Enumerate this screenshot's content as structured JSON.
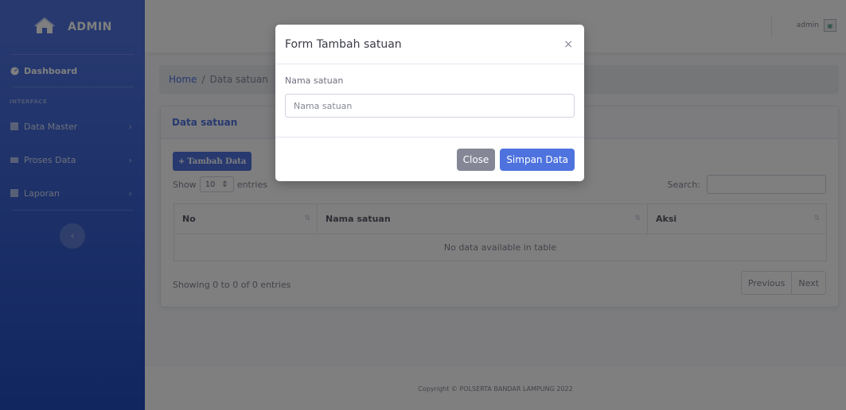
{
  "sidebar": {
    "brand": "ADMIN",
    "dashboard": "Dashboard",
    "heading": "INTERFACE",
    "items": [
      {
        "label": "Data Master"
      },
      {
        "label": "Proses Data"
      },
      {
        "label": "Laporan"
      }
    ]
  },
  "topbar": {
    "user": "admin"
  },
  "breadcrumb": {
    "home": "Home",
    "separator": "/",
    "current": "Data satuan"
  },
  "card": {
    "title": "Data satuan",
    "add_button": "Tambah Data",
    "show_label": "Show",
    "page_size": "10",
    "entries_label": "entries",
    "search_label": "Search:",
    "columns": [
      "No",
      "Nama satuan",
      "Aksi"
    ],
    "empty": "No data available in table",
    "info": "Showing 0 to 0 of 0 entries",
    "prev": "Previous",
    "next": "Next"
  },
  "footer": {
    "text": "Copyright © POLSERTA BANDAR LAMPUNG 2022"
  },
  "modal": {
    "title": "Form Tambah satuan",
    "close_symbol": "×",
    "field_label": "Nama satuan",
    "field_placeholder": "Nama satuan",
    "close_button": "Close",
    "save_button": "Simpan Data"
  }
}
